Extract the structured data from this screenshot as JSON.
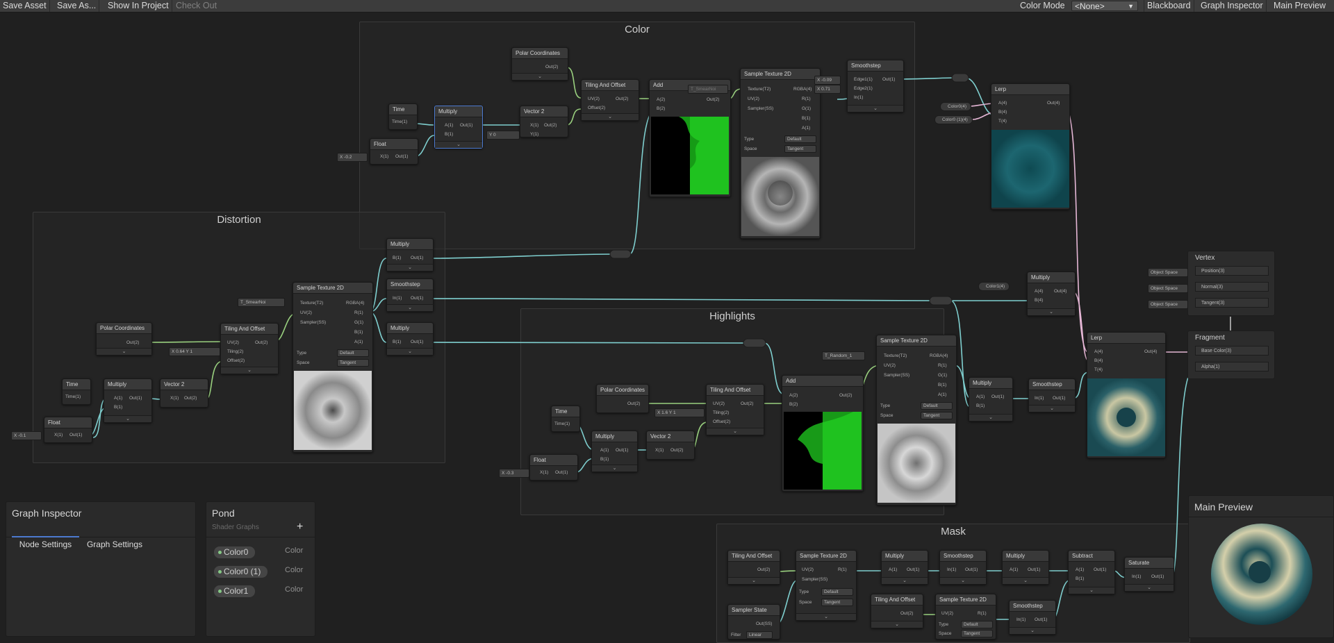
{
  "toolbar": {
    "save_asset": "Save Asset",
    "save_as": "Save As...",
    "show_in_project": "Show In Project",
    "check_out": "Check Out",
    "color_mode_label": "Color Mode",
    "color_mode_value": "<None>",
    "blackboard": "Blackboard",
    "graph_inspector": "Graph Inspector",
    "main_preview": "Main Preview"
  },
  "groups": {
    "color": "Color",
    "distortion": "Distortion",
    "highlights": "Highlights",
    "mask": "Mask"
  },
  "nodes": {
    "polar": "Polar Coordinates",
    "tiling": "Tiling And Offset",
    "time": "Time",
    "multiply": "Multiply",
    "vector2": "Vector 2",
    "float": "Float",
    "add": "Add",
    "sample": "Sample Texture 2D",
    "smoothstep": "Smoothstep",
    "lerp": "Lerp",
    "subtract": "Subtract",
    "saturate": "Saturate",
    "sampler_state": "Sampler State"
  },
  "ports": {
    "out2": "Out(2)",
    "out1": "Out(1)",
    "out4": "Out(4)",
    "uv2": "UV(2)",
    "tiling2": "Tiling(2)",
    "offset2": "Offset(2)",
    "time1": "Time(1)",
    "a1": "A(1)",
    "b1": "B(1)",
    "a2": "A(2)",
    "b2": "B(2)",
    "a4": "A(4)",
    "b4": "B(4)",
    "t4": "T(4)",
    "x1": "X(1)",
    "y1": "Y(1)",
    "texture": "Texture(T2)",
    "sampler": "Sampler(SS)",
    "rgba": "RGBA(4)",
    "r1": "R(1)",
    "g1": "G(1)",
    "b1c": "B(1)",
    "a1c": "A(1)",
    "edge1": "Edge1(1)",
    "edge2": "Edge2(1)",
    "in1": "In(1)",
    "type": "Type",
    "space": "Space",
    "default": "Default",
    "tangent": "Tangent",
    "outss": "Out(SS)",
    "filter": "Filter",
    "linear": "Linear"
  },
  "values": {
    "color_float_x": "-0.2",
    "dist_float_x": "-0.1",
    "high_float_x": "-0.3",
    "color_vec_y": "0",
    "dist_tiling_x": "0.64",
    "dist_tiling_y": "1",
    "high_tiling_x": "1.6",
    "high_tiling_y": "1",
    "edge1_x": "-0.09",
    "edge2_x": "0.71",
    "tex_smear": "T_SmearNoi",
    "tex_smear2": "T_SmearNoi",
    "tex_random": "T_Random_1"
  },
  "props": {
    "color0": "Color0(4)",
    "color0_1": "Color0 (1)(4)",
    "color1": "Color1(4)",
    "x_label": "X",
    "y_label": "Y"
  },
  "master": {
    "vertex": "Vertex",
    "position": "Position(3)",
    "normal": "Normal(3)",
    "tangent": "Tangent(3)",
    "object_space": "Object Space",
    "fragment": "Fragment",
    "base_color": "Base Color(3)",
    "alpha": "Alpha(1)"
  },
  "graph_inspector": {
    "title": "Graph Inspector",
    "tab_node": "Node Settings",
    "tab_graph": "Graph Settings"
  },
  "blackboard": {
    "title": "Pond",
    "subtitle": "Shader Graphs",
    "add": "+",
    "items": [
      {
        "name": "Color0",
        "type": "Color"
      },
      {
        "name": "Color0 (1)",
        "type": "Color"
      },
      {
        "name": "Color1",
        "type": "Color"
      }
    ]
  },
  "main_preview": {
    "title": "Main Preview"
  },
  "colors": {
    "wire_float": "#7fcfcf",
    "wire_vec2": "#9ad17f",
    "wire_vec4": "#e6b7d6",
    "background": "#202020",
    "node_header": "#393939"
  }
}
